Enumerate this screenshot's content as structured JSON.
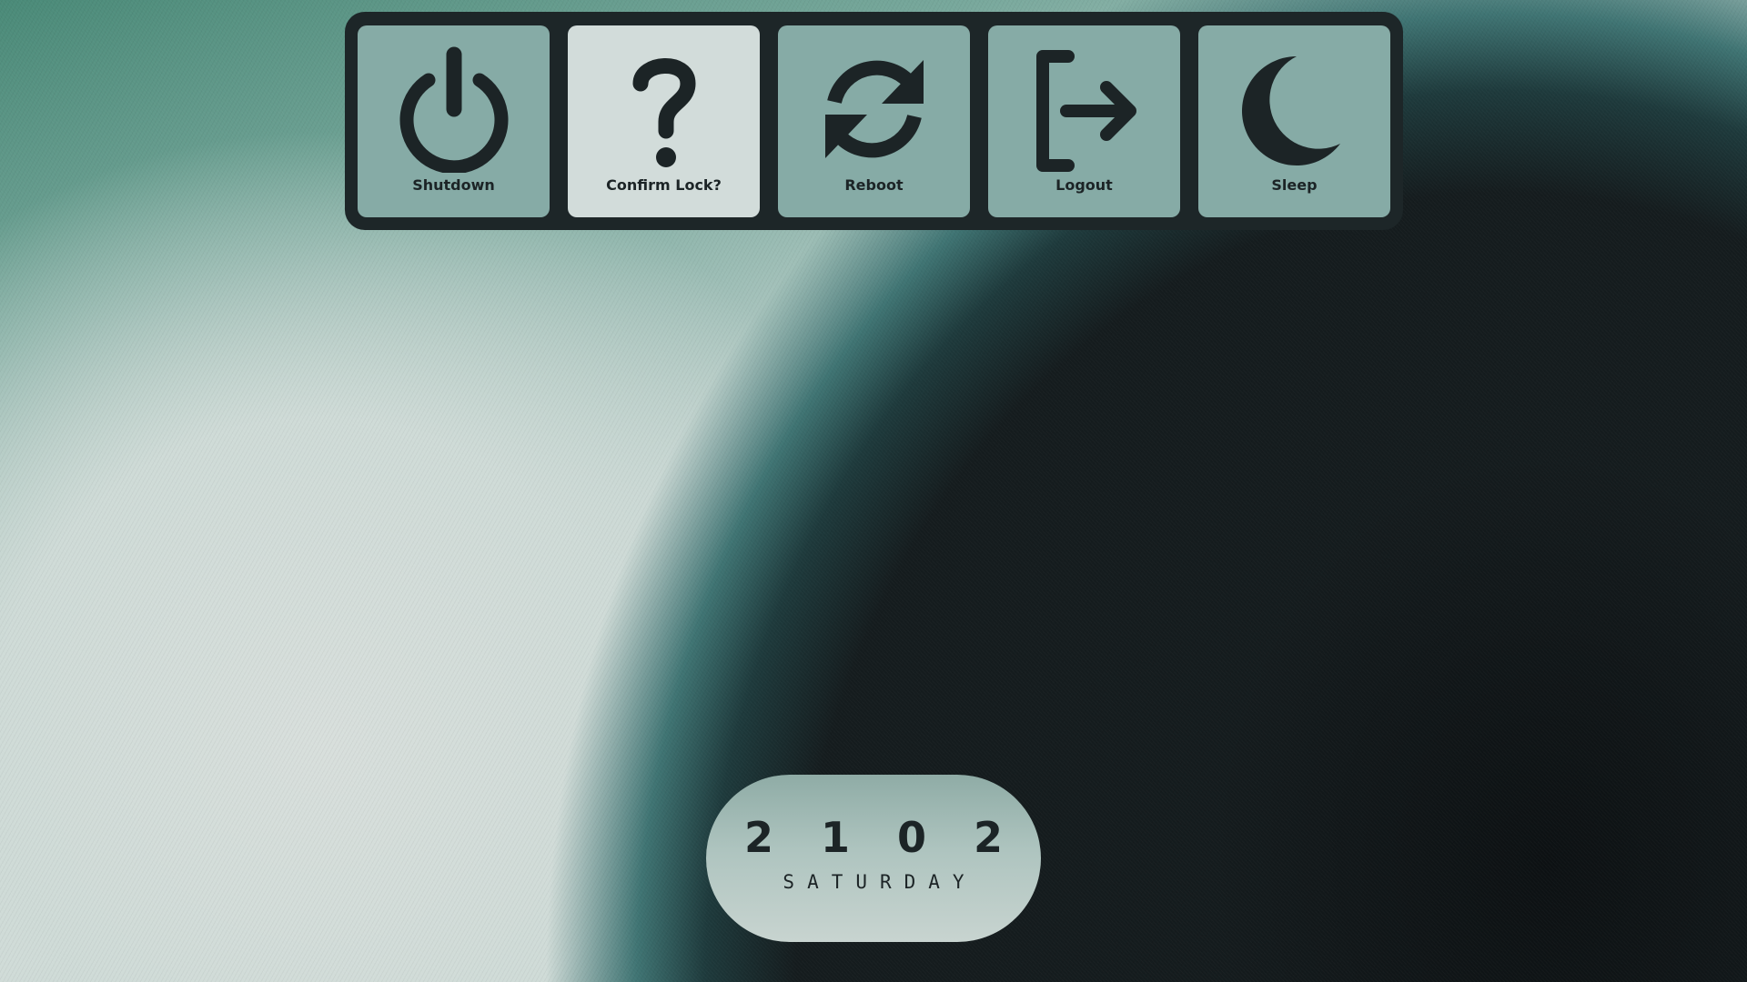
{
  "power_menu": {
    "buttons": [
      {
        "label": "Shutdown",
        "icon": "power-icon",
        "selected": false
      },
      {
        "label": "Confirm Lock?",
        "icon": "question-icon",
        "selected": true
      },
      {
        "label": "Reboot",
        "icon": "refresh-icon",
        "selected": false
      },
      {
        "label": "Logout",
        "icon": "logout-icon",
        "selected": false
      },
      {
        "label": "Sleep",
        "icon": "moon-icon",
        "selected": false
      }
    ]
  },
  "clock": {
    "digits": [
      "2",
      "1",
      "0",
      "2"
    ],
    "day": "SATURDAY"
  },
  "colors": {
    "panel": "#1d2628",
    "button": "#86aba6",
    "button_selected": "#d2dcda",
    "icon": "#1c2426"
  }
}
